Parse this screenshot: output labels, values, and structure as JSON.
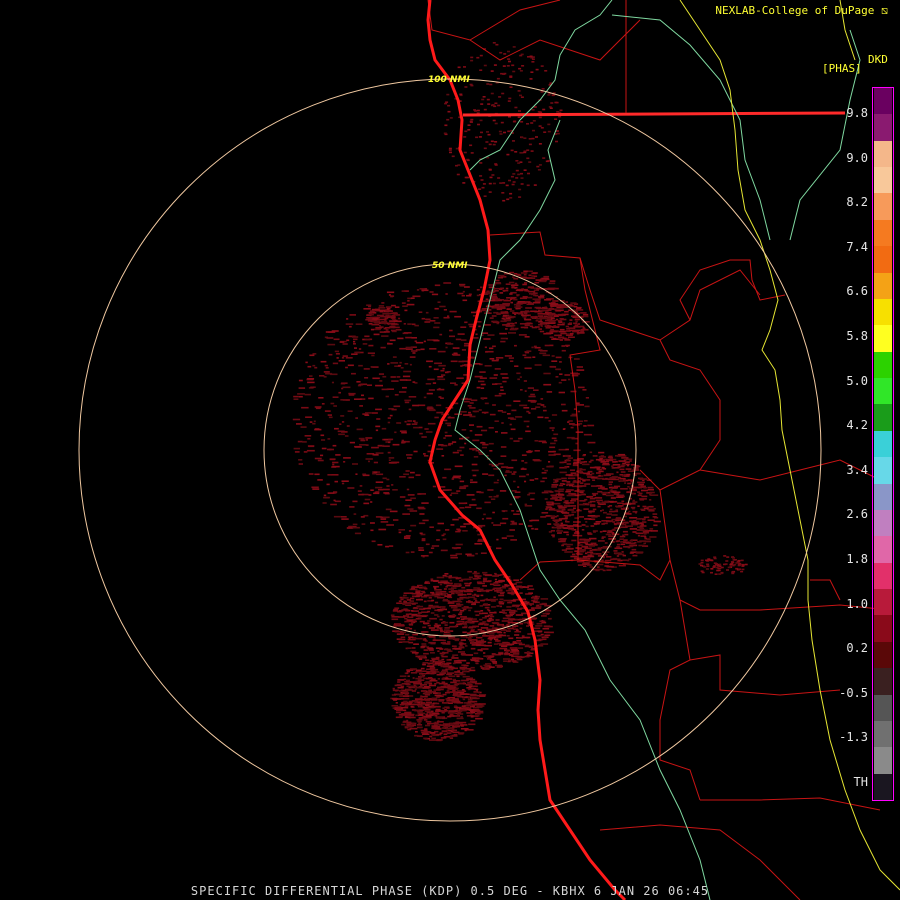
{
  "header": {
    "credit": "NEXLAB-College of DuPage",
    "product_code": "DKD",
    "unit": "[PHAS]"
  },
  "status_bar": {
    "text": "SPECIFIC DIFFERENTIAL PHASE (KDP) 0.5 DEG - KBHX 6 JAN 26 06:45"
  },
  "range_rings": {
    "inner_label": "50 NMI",
    "outer_label": "100 NMI"
  },
  "legend": {
    "labels": [
      "9.8",
      "9.0",
      "8.2",
      "7.4",
      "6.6",
      "5.8",
      "5.0",
      "4.2",
      "3.4",
      "2.6",
      "1.8",
      "1.0",
      "0.2",
      "-0.5",
      "-1.3",
      "TH"
    ],
    "colors": [
      "#6a0060",
      "#8a1a70",
      "#f4b78a",
      "#f8c89a",
      "#f79a5a",
      "#f57a20",
      "#f26b12",
      "#f4a216",
      "#f7e000",
      "#ffff20",
      "#2cd200",
      "#30e628",
      "#1a9c1a",
      "#3ad0d8",
      "#67d8e8",
      "#8a96c8",
      "#c07fc0",
      "#e067a8",
      "#e2306a",
      "#b81a3a",
      "#8a0a1a",
      "#5a0808",
      "#3a2020",
      "#555555",
      "#707070",
      "#8a8a8a",
      "#1a1620"
    ],
    "colors_role": "top-to-bottom color scale"
  },
  "map_colors": {
    "coast": "#ff1a1a",
    "county": "#c81414",
    "state_line": "#ff2a2a",
    "rivers_boundary": "#7fd8a0",
    "highway": "#e6e633",
    "rings": "#f0c8a0",
    "echo": "#7a0a14"
  }
}
